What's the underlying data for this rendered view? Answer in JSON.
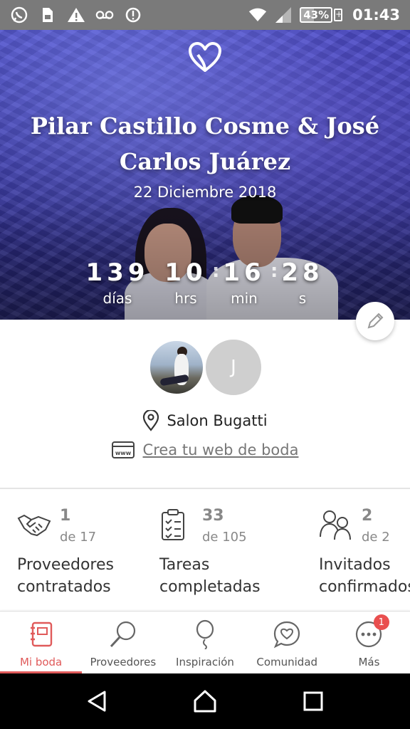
{
  "status_bar": {
    "battery": "43%",
    "time": "01:43",
    "icons": [
      "whatsapp-icon",
      "sim-icon",
      "warning-icon",
      "voicemail-icon",
      "sync-icon",
      "wifi-icon",
      "signal-icon",
      "battery-icon"
    ]
  },
  "hero": {
    "couple_names": "Pilar Castillo Cosme & José Carlos Juárez",
    "date": "22 Diciembre 2018",
    "countdown": {
      "days": "139",
      "days_label": "días",
      "hours": "10",
      "hours_label": "hrs",
      "minutes": "16",
      "minutes_label": "min",
      "seconds": "28",
      "seconds_label": "s"
    }
  },
  "profile": {
    "partner_initial": "J",
    "venue": "Salon Bugatti",
    "web_link": "Crea tu web de boda"
  },
  "stats": [
    {
      "value": "1",
      "of": "de 17",
      "label_line1": "Proveedores",
      "label_line2": "contratados",
      "icon": "handshake-icon"
    },
    {
      "value": "33",
      "of": "de 105",
      "label_line1": "Tareas",
      "label_line2": "completadas",
      "icon": "clipboard-checklist-icon"
    },
    {
      "value": "2",
      "of": "de 2",
      "label_line1": "Invitados",
      "label_line2": "confirmados",
      "icon": "guests-icon"
    }
  ],
  "tabs": [
    {
      "label": "Mi boda",
      "icon": "notebook-icon",
      "active": true
    },
    {
      "label": "Proveedores",
      "icon": "magnifier-icon"
    },
    {
      "label": "Inspiración",
      "icon": "balloon-icon"
    },
    {
      "label": "Comunidad",
      "icon": "chat-heart-icon"
    },
    {
      "label": "Más",
      "icon": "more-icon",
      "badge": "1"
    }
  ],
  "colors": {
    "accent": "#e05a5a",
    "badge": "#e94f4f",
    "status_bar": "#7a7a7a",
    "hero_tint": "#3b39b5"
  }
}
